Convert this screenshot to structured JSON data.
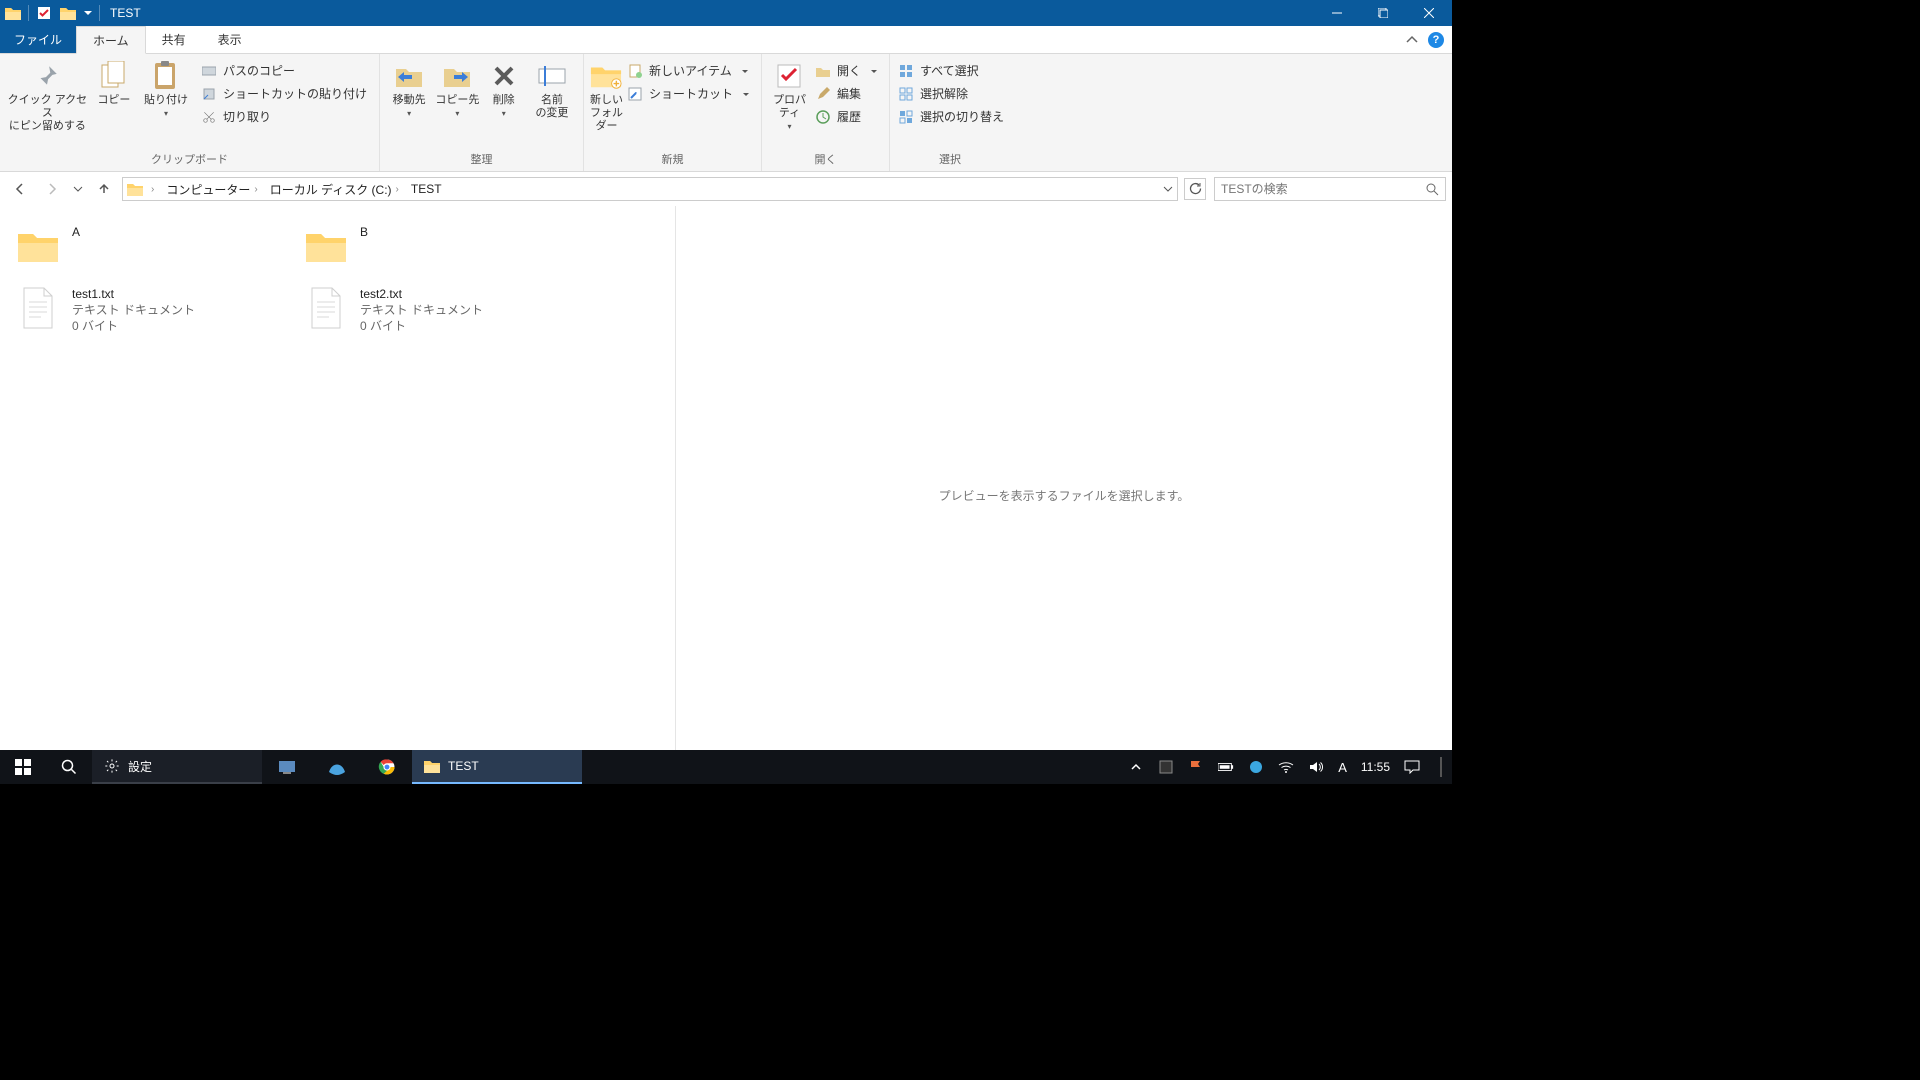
{
  "titlebar": {
    "title": "TEST"
  },
  "tabs": {
    "file": "ファイル",
    "home": "ホーム",
    "share": "共有",
    "view": "表示"
  },
  "ribbon": {
    "clipboard": {
      "pin": "クイック アクセス\nにピン留めする",
      "copy": "コピー",
      "paste": "貼り付け",
      "copy_path": "パスのコピー",
      "paste_shortcut": "ショートカットの貼り付け",
      "cut": "切り取り",
      "group_label": "クリップボード"
    },
    "organize": {
      "move_to": "移動先",
      "copy_to": "コピー先",
      "delete": "削除",
      "rename": "名前\nの変更",
      "group_label": "整理"
    },
    "new": {
      "new_folder": "新しい\nフォルダー",
      "new_item": "新しいアイテム",
      "shortcut": "ショートカット",
      "group_label": "新規"
    },
    "open": {
      "properties": "プロパティ",
      "open": "開く",
      "edit": "編集",
      "history": "履歴",
      "group_label": "開く"
    },
    "select": {
      "select_all": "すべて選択",
      "select_none": "選択解除",
      "invert": "選択の切り替え",
      "group_label": "選択"
    }
  },
  "breadcrumb": {
    "computer": "コンピューター",
    "localdisk": "ローカル ディスク (C:)",
    "folder": "TEST"
  },
  "search": {
    "placeholder": "TESTの検索"
  },
  "items": [
    {
      "name": "A",
      "kind": "folder"
    },
    {
      "name": "B",
      "kind": "folder"
    },
    {
      "name": "test1.txt",
      "kind": "file",
      "type_label": "テキスト ドキュメント",
      "size_label": "0 バイト"
    },
    {
      "name": "test2.txt",
      "kind": "file",
      "type_label": "テキスト ドキュメント",
      "size_label": "0 バイト"
    }
  ],
  "preview": {
    "empty_label": "プレビューを表示するファイルを選択します。"
  },
  "taskbar": {
    "settings_label": "設定",
    "explorer_label": "TEST",
    "clock": "11:55",
    "ime": "A"
  }
}
